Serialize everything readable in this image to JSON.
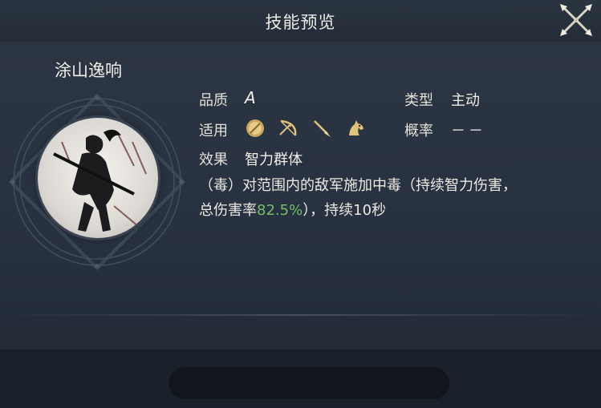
{
  "window": {
    "title": "技能预览"
  },
  "skill": {
    "name": "涂山逸响",
    "quality_label": "品质",
    "quality_value": "A",
    "type_label": "类型",
    "type_value": "主动",
    "applicable_label": "适用",
    "applicable_icons": [
      "shield-icon",
      "bow-icon",
      "spear-icon",
      "horse-icon"
    ],
    "rate_label": "概率",
    "rate_value": "－－",
    "effect_label": "效果",
    "effect_value": "智力群体",
    "description": {
      "part1": "（毒）对范围内的敌军施加中毒（持续智力伤害，",
      "part2_prefix": "总伤害率",
      "percent": "82.5%",
      "part2_suffix": "），持续10秒"
    }
  },
  "colors": {
    "accent_green": "#6fbf6a",
    "icon_gold": "#e0c27a"
  }
}
